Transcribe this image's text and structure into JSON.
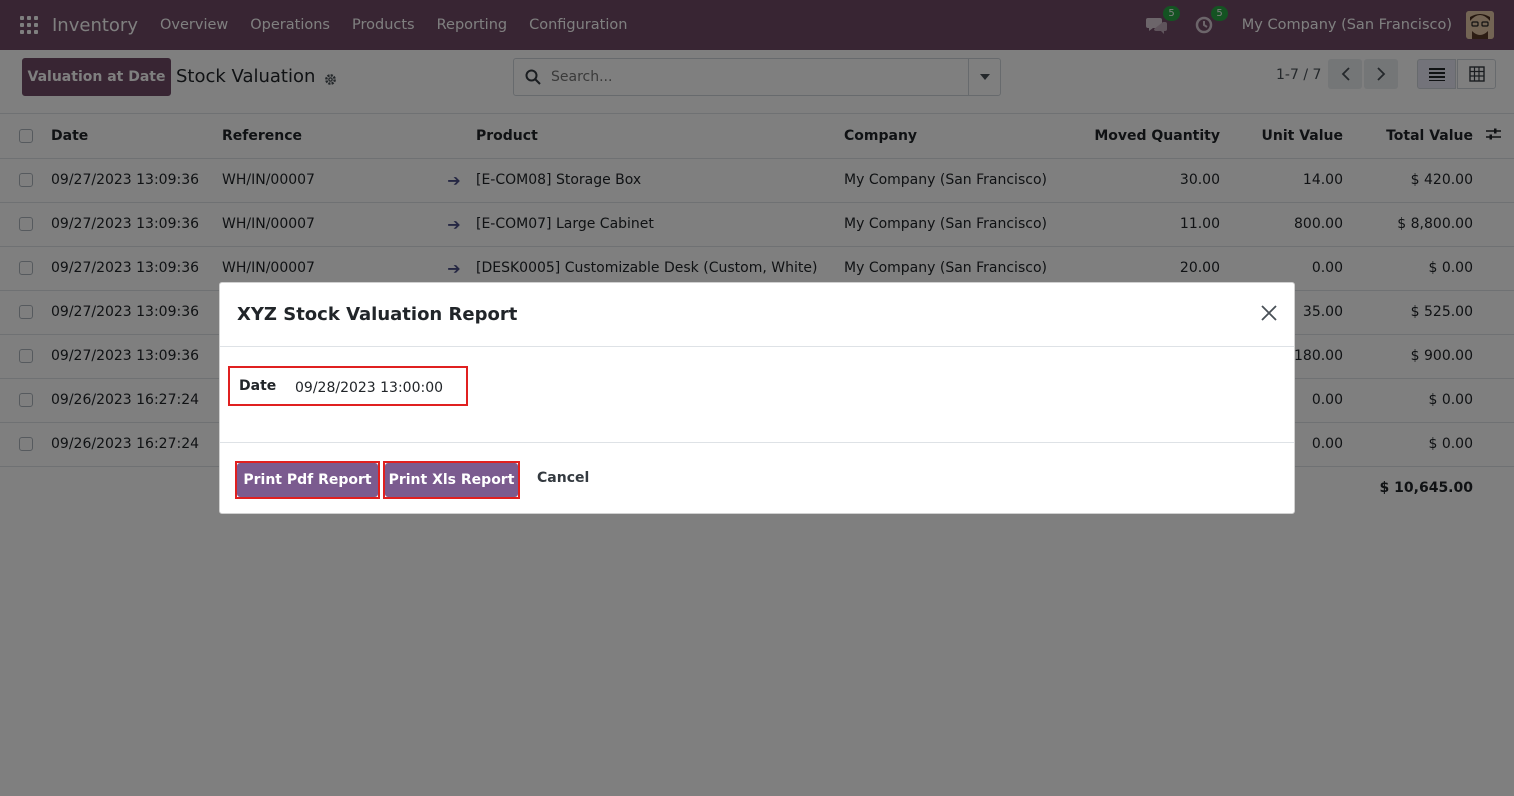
{
  "navbar": {
    "app_name": "Inventory",
    "menu": [
      "Overview",
      "Operations",
      "Products",
      "Reporting",
      "Configuration"
    ],
    "messages_count": "5",
    "activities_count": "5",
    "company": "My Company (San Francisco)"
  },
  "control_panel": {
    "valuation_button": "Valuation at Date",
    "title": "Stock Valuation",
    "search_placeholder": "Search...",
    "pager": "1-7 / 7"
  },
  "table": {
    "headers": [
      "Date",
      "Reference",
      "Product",
      "Company",
      "Moved Quantity",
      "Unit Value",
      "Total Value"
    ],
    "rows": [
      {
        "date": "09/27/2023 13:09:36",
        "reference": "WH/IN/00007",
        "product": "[E-COM08] Storage Box",
        "company": "My Company (San Francisco)",
        "qty": "30.00",
        "unit": "14.00",
        "total": "$ 420.00"
      },
      {
        "date": "09/27/2023 13:09:36",
        "reference": "WH/IN/00007",
        "product": "[E-COM07] Large Cabinet",
        "company": "My Company (San Francisco)",
        "qty": "11.00",
        "unit": "800.00",
        "total": "$ 8,800.00"
      },
      {
        "date": "09/27/2023 13:09:36",
        "reference": "WH/IN/00007",
        "product": "[DESK0005] Customizable Desk (Custom, White)",
        "company": "My Company (San Francisco)",
        "qty": "20.00",
        "unit": "0.00",
        "total": "$ 0.00"
      },
      {
        "date": "09/27/2023 13:09:36",
        "reference": "",
        "product": "",
        "company": "",
        "qty": "",
        "unit": "35.00",
        "total": "$ 525.00"
      },
      {
        "date": "09/27/2023 13:09:36",
        "reference": "",
        "product": "",
        "company": "",
        "qty": "",
        "unit": "180.00",
        "total": "$ 900.00"
      },
      {
        "date": "09/26/2023 16:27:24",
        "reference": "",
        "product": "",
        "company": "",
        "qty": "",
        "unit": "0.00",
        "total": "$ 0.00"
      },
      {
        "date": "09/26/2023 16:27:24",
        "reference": "",
        "product": "",
        "company": "",
        "qty": "",
        "unit": "0.00",
        "total": "$ 0.00"
      }
    ],
    "grand_total": "$ 10,645.00"
  },
  "dialog": {
    "title": "XYZ Stock Valuation Report",
    "date_label": "Date",
    "date_value": "09/28/2023 13:00:00",
    "print_pdf": "Print Pdf Report",
    "print_xls": "Print Xls Report",
    "cancel": "Cancel"
  },
  "colors": {
    "brand": "#714b67",
    "highlight": "#e02020",
    "badge": "#28a745"
  }
}
